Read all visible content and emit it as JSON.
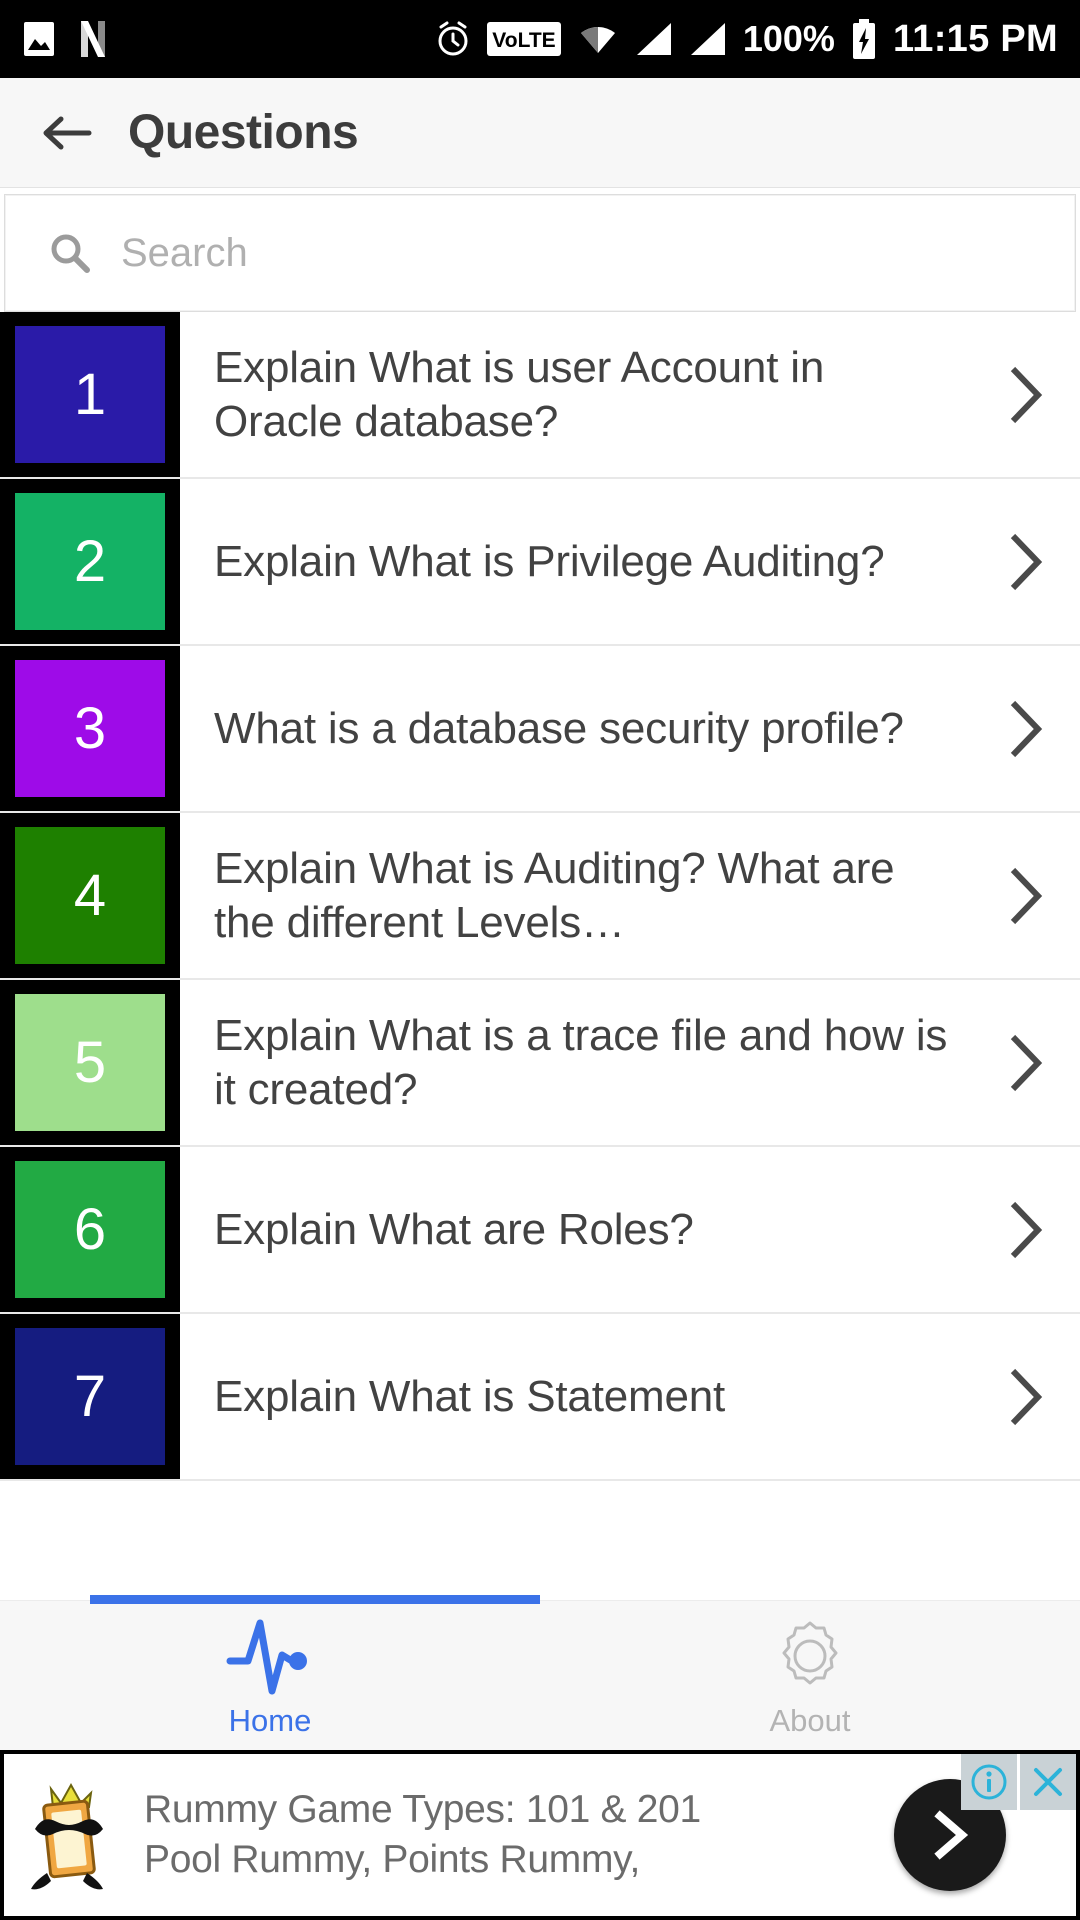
{
  "status_bar": {
    "icons_left": [
      "image-icon",
      "netflix-n-icon"
    ],
    "icons_right": [
      "alarm-clock-icon",
      "volte-icon",
      "wifi-icon",
      "signal-bar-icon",
      "signal-bar-2-icon"
    ],
    "volte_label": "VoLTE",
    "battery_percent": "100%",
    "time": "11:15 PM"
  },
  "app_bar": {
    "back_icon": "arrow-left-icon",
    "title": "Questions"
  },
  "search": {
    "icon": "search-icon",
    "placeholder": "Search",
    "value": ""
  },
  "list": {
    "chevron_icon": "chevron-right-icon",
    "items": [
      {
        "number": "1",
        "color": "#2A1BA8",
        "text": "Explain What is user Account in Oracle database?"
      },
      {
        "number": "2",
        "color": "#14B265",
        "text": "Explain What is Privilege Auditing?"
      },
      {
        "number": "3",
        "color": "#9E0BE8",
        "text": "What is a database security profile?"
      },
      {
        "number": "4",
        "color": "#1E8000",
        "text": "Explain What is Auditing? What are the different Levels…"
      },
      {
        "number": "5",
        "color": "#9EDE8C",
        "text": "Explain What is a trace file and how is it created?"
      },
      {
        "number": "6",
        "color": "#22AA44",
        "text": "Explain What are Roles?"
      },
      {
        "number": "7",
        "color": "#151C80",
        "text": "Explain What is Statement"
      }
    ]
  },
  "bottom_nav": {
    "accent_color": "#3b72e8",
    "items": [
      {
        "label": "Home",
        "icon": "pulse-activity-icon",
        "active": true
      },
      {
        "label": "About",
        "icon": "gear-icon",
        "active": false
      }
    ]
  },
  "ad": {
    "mascot_icon": "rummy-card-mascot-icon",
    "line1": "Rummy Game Types: 101 & 201",
    "line2": "Pool Rummy, Points Rummy,",
    "cta_icon": "chevron-right-icon",
    "info_icon": "info-icon",
    "close_icon": "close-x-icon"
  }
}
